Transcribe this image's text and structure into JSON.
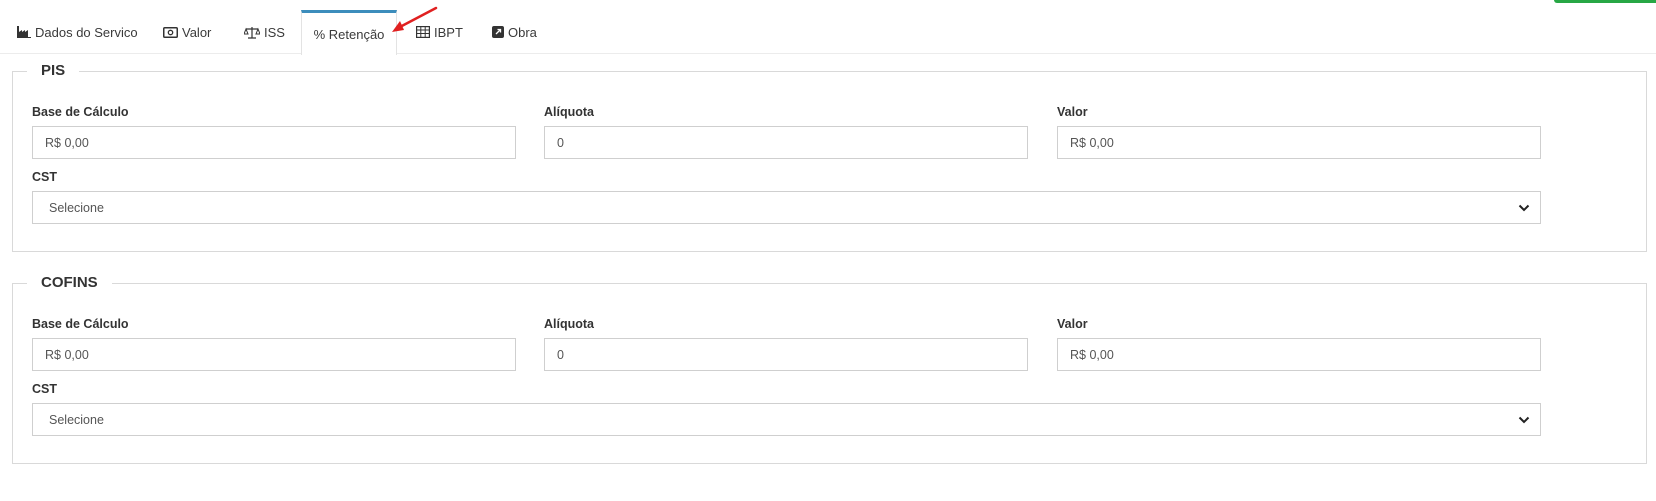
{
  "tabs": [
    {
      "label": "Dados do Servico",
      "icon": "factory-icon"
    },
    {
      "label": "Valor",
      "icon": "money-icon"
    },
    {
      "label": "ISS",
      "icon": "scale-icon"
    },
    {
      "label": "% Retenção",
      "icon": "",
      "active": true
    },
    {
      "label": "IBPT",
      "icon": "table-icon"
    },
    {
      "label": "Obra",
      "icon": "external-link-icon"
    }
  ],
  "pis": {
    "title": "PIS",
    "base_label": "Base de Cálculo",
    "base_value": "R$ 0,00",
    "aliquota_label": "Alíquota",
    "aliquota_value": "0",
    "valor_label": "Valor",
    "valor_value": "R$ 0,00",
    "cst_label": "CST",
    "cst_selected": "Selecione"
  },
  "cofins": {
    "title": "COFINS",
    "base_label": "Base de Cálculo",
    "base_value": "R$ 0,00",
    "aliquota_label": "Alíquota",
    "aliquota_value": "0",
    "valor_label": "Valor",
    "valor_value": "R$ 0,00",
    "cst_label": "CST",
    "cst_selected": "Selecione"
  },
  "colors": {
    "active_tab_accent": "#3c8dbc",
    "annotation_arrow": "#e02020",
    "corner_button": "#28a745"
  }
}
